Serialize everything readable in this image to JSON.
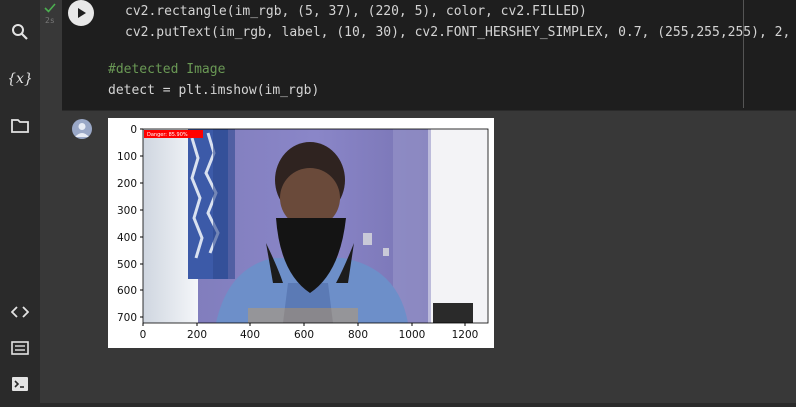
{
  "sidebar": {
    "icons": [
      "search-icon",
      "variables-icon",
      "folder-icon",
      "code-snippets-icon",
      "command-palette-icon",
      "terminal-icon"
    ]
  },
  "cell": {
    "exec_count": "2s",
    "code_lines": [
      "cv2.rectangle(im_rgb, (5, 37), (220, 5), color, cv2.FILLED)",
      "cv2.putText(im_rgb, label, (10, 30), cv2.FONT_HERSHEY_SIMPLEX, 0.7, (255,255,255), 2,",
      "#detected Image",
      "detect = plt.imshow(im_rgb)"
    ]
  },
  "output": {
    "detection_label": "Danger: 85.90%",
    "y_ticks": [
      "0",
      "100",
      "200",
      "300",
      "400",
      "500",
      "600",
      "700"
    ],
    "x_ticks": [
      "0",
      "200",
      "400",
      "600",
      "800",
      "1000",
      "1200"
    ]
  },
  "colors": {
    "detection_box": "#ff0000",
    "sidebar_bg": "#2a2a2a",
    "editor_bg": "#1e1e1e"
  }
}
